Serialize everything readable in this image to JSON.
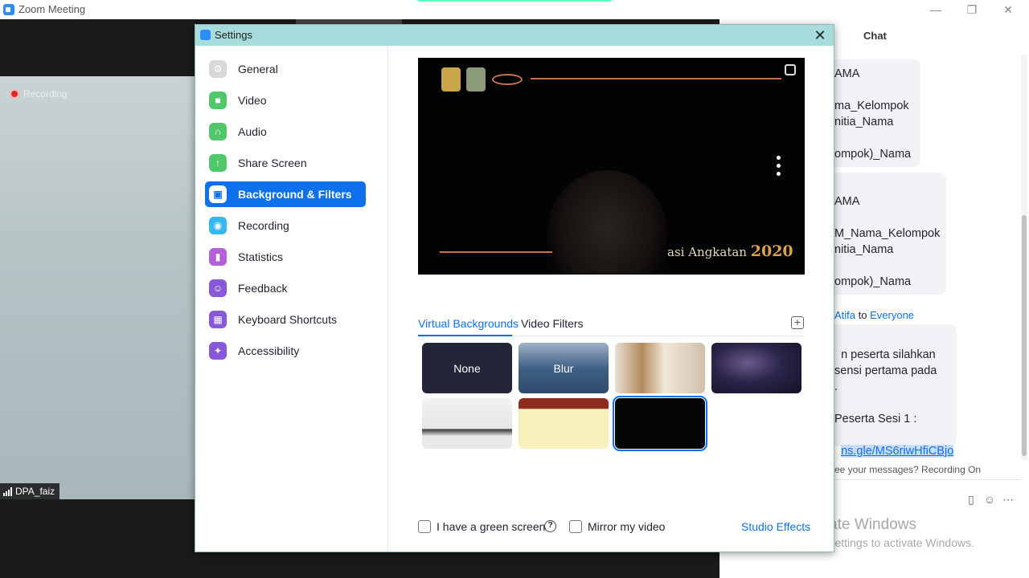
{
  "window": {
    "title": "Zoom Meeting",
    "minimize": "—",
    "maximize": "❐",
    "close": "✕"
  },
  "meeting": {
    "recording_label": "Recording",
    "participant_name": "DPA_faiz"
  },
  "chat": {
    "title": "Chat",
    "bubble1": "AMA\n\nma_Kelompok\nnitia_Nama\n\nompok)_Nama",
    "bubble2": "AMA\n\nM_Nama_Kelompok\nnitia_Nama\n\nompok)_Nama",
    "sender_name": "Atifa",
    "sender_to": "to",
    "sender_target": "Everyone",
    "bubble3_text": "n peserta silahkan\nsensi pertama pada\n.\n\nPeserta Sesi 1 :",
    "bubble3_link": "ns.gle/MS6riwHfiCBjo",
    "note": "ee your messages? Recording On",
    "activate_title": "Activate Windows",
    "activate_sub": "Go to Settings to activate Windows."
  },
  "settings": {
    "title": "Settings",
    "close": "✕",
    "nav": [
      {
        "label": "General",
        "icon": "gear-icon",
        "color": "#d8d8d8"
      },
      {
        "label": "Video",
        "icon": "video-camera-icon",
        "color": "#4fc76a"
      },
      {
        "label": "Audio",
        "icon": "headphones-icon",
        "color": "#4fc76a"
      },
      {
        "label": "Share Screen",
        "icon": "share-screen-icon",
        "color": "#4fc76a"
      },
      {
        "label": "Background & Filters",
        "icon": "background-icon",
        "color": "#ffffff"
      },
      {
        "label": "Recording",
        "icon": "recording-icon",
        "color": "#37b7f0"
      },
      {
        "label": "Statistics",
        "icon": "statistics-icon",
        "color": "#b460d8"
      },
      {
        "label": "Feedback",
        "icon": "feedback-icon",
        "color": "#8758d8"
      },
      {
        "label": "Keyboard Shortcuts",
        "icon": "keyboard-icon",
        "color": "#8758d8"
      },
      {
        "label": "Accessibility",
        "icon": "accessibility-icon",
        "color": "#8758d8"
      }
    ],
    "active_nav": "Background & Filters",
    "preview_caption": "asi Angkatan",
    "preview_year": "2020",
    "tabs": {
      "virtual": "Virtual Backgrounds",
      "filters": "Video Filters",
      "active": "Virtual Backgrounds"
    },
    "backgrounds": [
      {
        "label": "None",
        "selected": false
      },
      {
        "label": "Blur",
        "selected": false
      },
      {
        "label": "",
        "selected": false
      },
      {
        "label": "",
        "selected": false
      },
      {
        "label": "",
        "selected": false
      },
      {
        "label": "",
        "selected": false
      },
      {
        "label": "",
        "selected": true
      }
    ],
    "green_screen_label": "I have a green screen",
    "green_screen_checked": false,
    "mirror_label": "Mirror my video",
    "mirror_checked": false,
    "help_glyph": "?",
    "studio_effects": "Studio Effects"
  }
}
